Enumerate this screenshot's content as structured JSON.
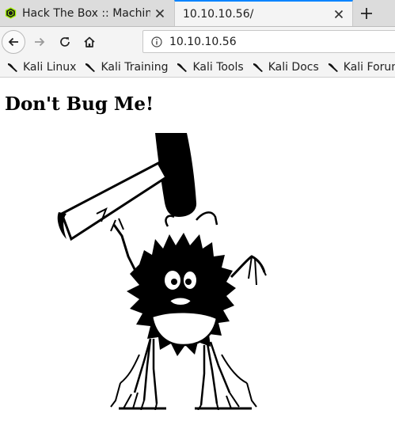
{
  "tabs": [
    {
      "title": "Hack The Box :: Machines",
      "active": false
    },
    {
      "title": "10.10.10.56/",
      "active": true
    }
  ],
  "url": "10.10.10.56",
  "bookmarks": [
    "Kali Linux",
    "Kali Training",
    "Kali Tools",
    "Kali Docs",
    "Kali Forums"
  ],
  "page": {
    "heading": "Don't Bug Me!"
  },
  "colors": {
    "tab_accent": "#0a84ff",
    "htb_green": "#9fef00"
  }
}
